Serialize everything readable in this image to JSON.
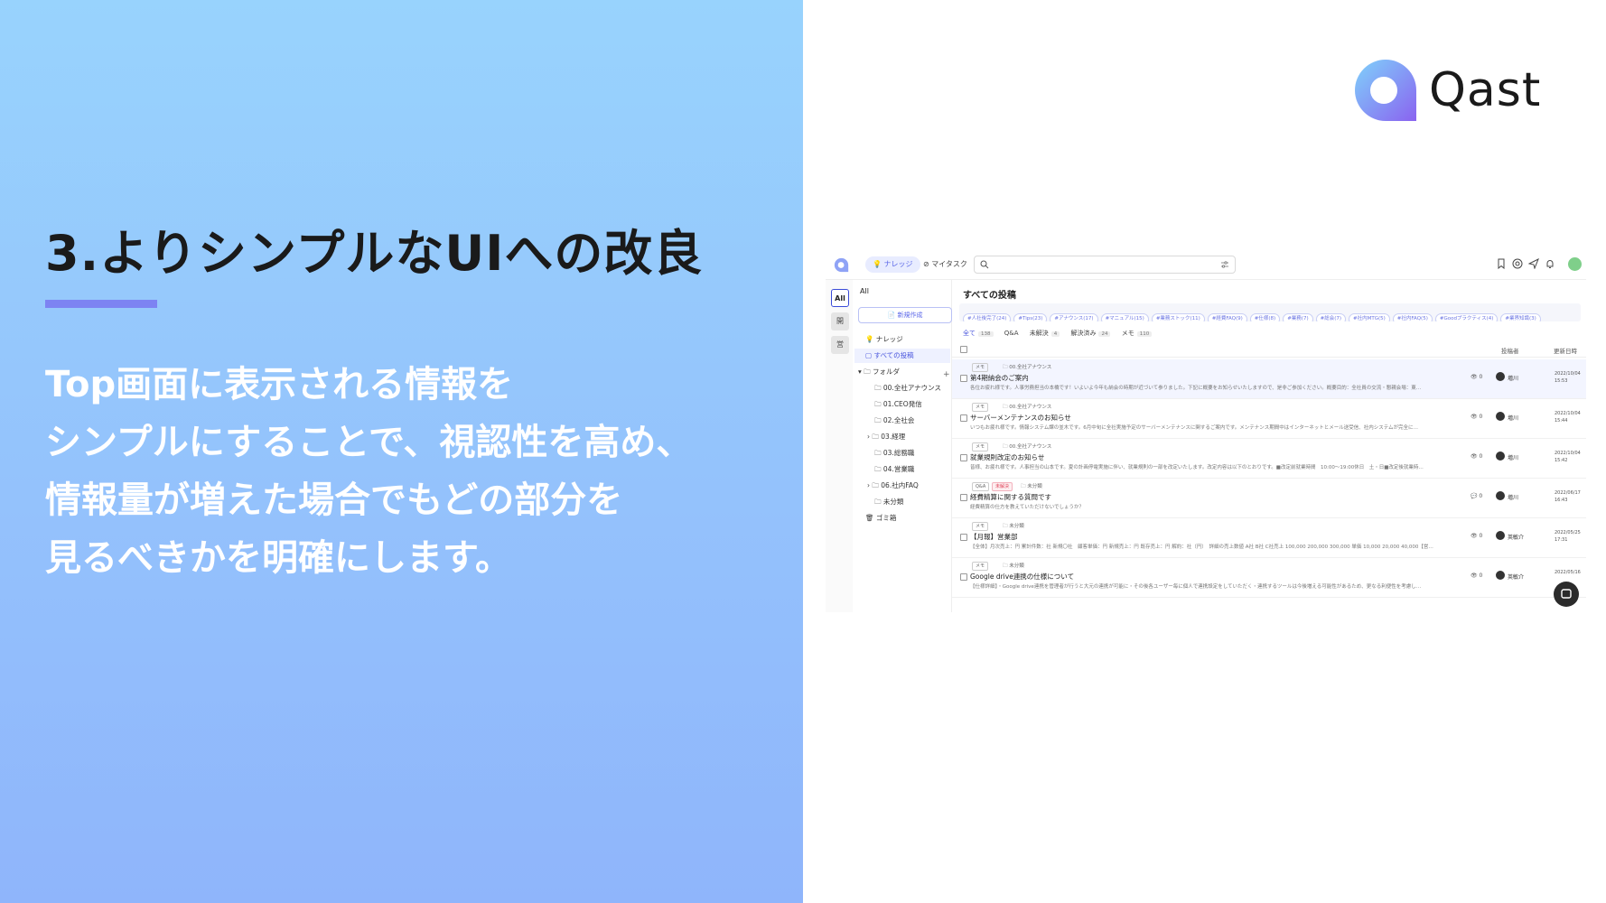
{
  "slide": {
    "title": "3.よりシンプルなUIへの改良",
    "description_lines": [
      "Top画面に表示される情報を",
      "シンプルにすることで、視認性を高め、",
      "情報量が増えた場合でもどの部分を",
      "見るべきかを明確にします。"
    ],
    "accent_color": "#7d83f2"
  },
  "logo": {
    "text": "Qast",
    "icon": "qast-logo-icon"
  },
  "app": {
    "nav": {
      "knowledge": "ナレッジ",
      "mytask": "マイタスク"
    },
    "rail": {
      "all": "All",
      "item2": "開",
      "item3": "営"
    },
    "sidebar": {
      "all_label": "All",
      "new_button": "新規作成",
      "knowledge": "ナレッジ",
      "all_posts": "すべての投稿",
      "folder": "フォルダ",
      "folders": [
        "00.全社アナウンス",
        "01.CEO発信",
        "02.全社会",
        "03.経理",
        "03.総務職",
        "04.営業職",
        "06.社内FAQ",
        "未分類"
      ],
      "trash": "ゴミ箱"
    },
    "main": {
      "title": "すべての投稿",
      "tags": [
        "#人社後完了(24)",
        "#Tips(23)",
        "#アナウンス(17)",
        "#マニュアル(15)",
        "#業務ストック(11)",
        "#経費FAQ(9)",
        "#仕様(8)",
        "#業務(7)",
        "#総会(7)",
        "#社内MTG(5)",
        "#社内FAQ(5)",
        "#Goodプラクティス(4)",
        "#業界知識(3)"
      ],
      "filters": [
        {
          "label": "全て",
          "count": "138"
        },
        {
          "label": "Q&A",
          "count": ""
        },
        {
          "label": "未解決",
          "count": "4"
        },
        {
          "label": "解決済み",
          "count": "24"
        },
        {
          "label": "メモ",
          "count": "110"
        }
      ],
      "columns": {
        "author": "投稿者",
        "updated": "更新日時"
      },
      "posts": [
        {
          "type": "メモ",
          "badge": "",
          "folder": "00.全社アナウンス",
          "title": "第4期納会のご案内",
          "body": "各位お疲れ様です。人事労務担当の本橋です！いよいよ今年も納会の時期が近づいて参りました。下記に概要をお知らせいたしますので、是非ご参加ください。概要目的：全社員の交流・懇親会場：東…",
          "views": "0",
          "author": "増川",
          "date": "2022/10/04 15:53"
        },
        {
          "type": "メモ",
          "badge": "",
          "folder": "00.全社アナウンス",
          "title": "サーバーメンテナンスのお知らせ",
          "body": "いつもお疲れ様です。情報システム課の並木です。6月中旬に全社実施予定のサーバーメンテナンスに関するご案内です。メンテナンス期間中はインターネットとメール送受信、社内システムが完全に…",
          "views": "0",
          "author": "増川",
          "date": "2022/10/04 15:44"
        },
        {
          "type": "メモ",
          "badge": "",
          "folder": "00.全社アナウンス",
          "title": "就業規則改定のお知らせ",
          "body": "皆様、お疲れ様です。人事担当の山本です。夏の計画停電実施に伴い、就業規則の一部を改定いたします。改定内容は以下のとおりです。■改定前就業時間　10:00〜19:00休日　土・日■改定後就業時…",
          "views": "0",
          "author": "増川",
          "date": "2022/10/04 15:42"
        },
        {
          "type": "Q&A",
          "badge": "未解決",
          "folder": "未分類",
          "title": "経費精算に関する質問です",
          "body": "経費精算の仕方を教えていただけないでしょうか？",
          "views": "0",
          "author": "増川",
          "date": "2022/06/17 16:43"
        },
        {
          "type": "メモ",
          "badge": "",
          "folder": "未分類",
          "title": "【月報】営業部",
          "body": "【全体】月次売上：円 累計件数：社 新規〇社　顧客単価：円 新規売上：円 既存売上：円 解約：社（円）　詳細の売上数値 A社 B社 C社売上 100,000 200,000 300,000 単価 10,000 20,000 40,000【営…",
          "views": "0",
          "author": "英敏介",
          "date": "2022/05/25 17:31"
        },
        {
          "type": "メモ",
          "badge": "",
          "folder": "未分類",
          "title": "Google drive連携の仕様について",
          "body": "【仕様詳細】・Google drive連携を管理者が行うと大元の連携が可能に・その後各ユーザー毎に個人で連携設定をしていただく・連携するツールは今後増える可能性があるため、更なる利便性を考慮し…",
          "views": "0",
          "author": "英敏介",
          "date": "2022/05/16"
        }
      ]
    }
  }
}
